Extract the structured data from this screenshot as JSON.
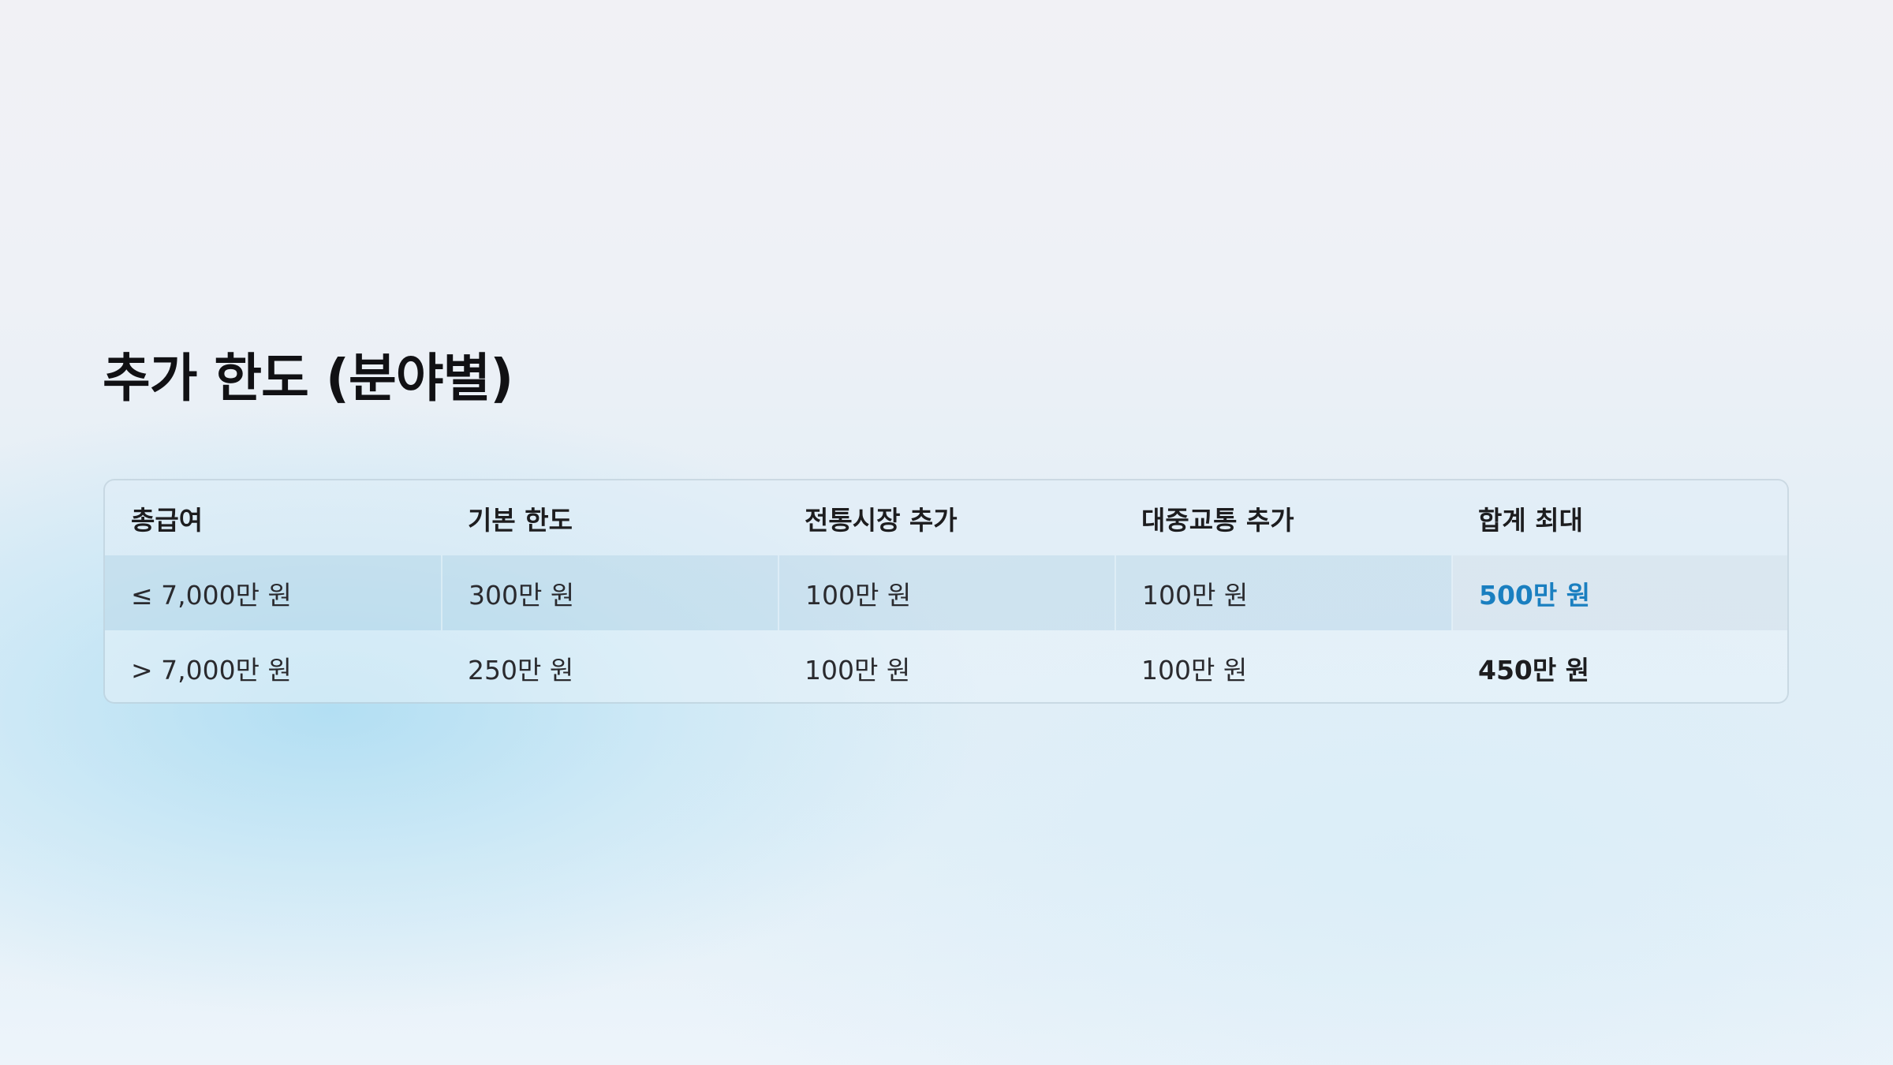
{
  "title": "추가 한도 (분야별)",
  "table": {
    "headers": [
      "총급여",
      "기본 한도",
      "전통시장 추가",
      "대중교통 추가",
      "합계 최대"
    ],
    "rows": [
      {
        "income": "≤ 7,000만 원",
        "base": "300만 원",
        "market": "100만 원",
        "transit": "100만 원",
        "total": "500만 원"
      },
      {
        "income": "> 7,000만 원",
        "base": "250만 원",
        "market": "100만 원",
        "transit": "100만 원",
        "total": "450만 원"
      }
    ]
  },
  "colors": {
    "accent": "#1a7fc0",
    "text": "#1d1d1f"
  }
}
